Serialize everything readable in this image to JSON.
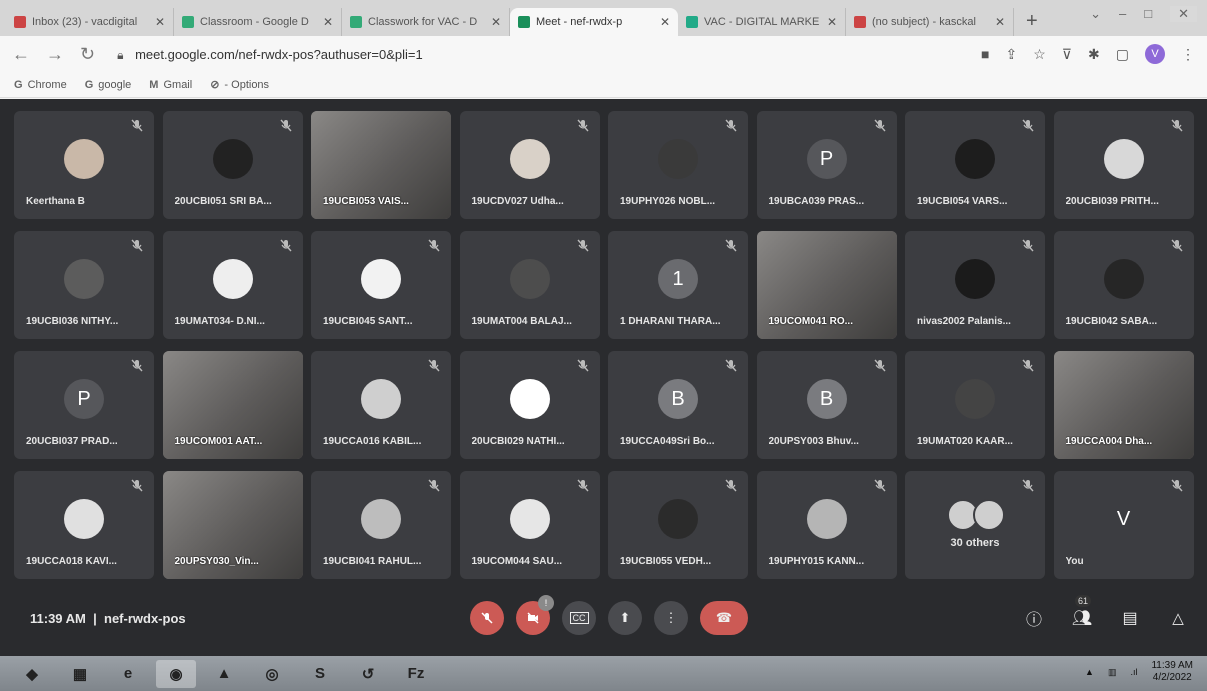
{
  "browser": {
    "tabs": [
      {
        "title": "Inbox (23) - vacdigital",
        "icon": "gmail-icon",
        "color": "#c44"
      },
      {
        "title": "Classroom - Google D",
        "icon": "classroom-icon",
        "color": "#3a7"
      },
      {
        "title": "Classwork for VAC - D",
        "icon": "classroom-icon",
        "color": "#3a7"
      },
      {
        "title": "Meet - nef-rwdx-p",
        "icon": "meet-icon",
        "color": "#1a8f5a",
        "active": true
      },
      {
        "title": "VAC - DIGITAL MARKE",
        "icon": "sheets-icon",
        "color": "#2a8"
      },
      {
        "title": "(no subject) - kasckal",
        "icon": "gmail-icon",
        "color": "#c44"
      }
    ],
    "url": "meet.google.com/nef-rwdx-pos?authuser=0&pli=1",
    "profile_initial": "V",
    "bookmarks": [
      {
        "label": "Chrome",
        "icon": "G"
      },
      {
        "label": "google",
        "icon": "G"
      },
      {
        "label": "Gmail",
        "icon": "M"
      },
      {
        "label": "- Options",
        "icon": "⊘"
      }
    ]
  },
  "participants": [
    {
      "name": "Keerthana B",
      "type": "photo",
      "color": "#c9b8a8"
    },
    {
      "name": "20UCBI051 SRI BA...",
      "type": "photo",
      "color": "#222"
    },
    {
      "name": "19UCBI053 VAIS...",
      "type": "video"
    },
    {
      "name": "19UCDV027 Udha...",
      "type": "photo",
      "color": "#d9d1c8"
    },
    {
      "name": "19UPHY026 NOBL...",
      "type": "photo",
      "color": "#3a3a3a"
    },
    {
      "name": "19UBCA039 PRAS...",
      "type": "initial",
      "initial": "P",
      "color": "#56575b"
    },
    {
      "name": "19UCBI054 VARS...",
      "type": "photo",
      "color": "#1d1d1d"
    },
    {
      "name": "20UCBI039 PRITH...",
      "type": "photo",
      "color": "#d8d8d8"
    },
    {
      "name": "19UCBI036 NITHY...",
      "type": "photo",
      "color": "#5c5c5c"
    },
    {
      "name": "19UMAT034- D.NI...",
      "type": "photo",
      "color": "#eeeeee"
    },
    {
      "name": "19UCBI045 SANT...",
      "type": "photo",
      "color": "#f2f2f2"
    },
    {
      "name": "19UMAT004 BALAJ...",
      "type": "photo",
      "color": "#4d4d4d"
    },
    {
      "name": "1 DHARANI THARA...",
      "type": "initial",
      "initial": "1",
      "color": "#6a6b6f"
    },
    {
      "name": "19UCOM041 RO...",
      "type": "video"
    },
    {
      "name": "nivas2002 Palanis...",
      "type": "photo",
      "color": "#1b1b1b"
    },
    {
      "name": "19UCBI042 SABA...",
      "type": "photo",
      "color": "#262626"
    },
    {
      "name": "20UCBI037 PRAD...",
      "type": "initial",
      "initial": "P",
      "color": "#56575b"
    },
    {
      "name": "19UCOM001 AAT...",
      "type": "video"
    },
    {
      "name": "19UCCA016 KABIL...",
      "type": "photo",
      "color": "#cfcfcf"
    },
    {
      "name": "20UCBI029 NATHI...",
      "type": "photo",
      "color": "#ffffff"
    },
    {
      "name": "19UCCA049Sri Bo...",
      "type": "initial",
      "initial": "B",
      "color": "#7a7b7f"
    },
    {
      "name": "20UPSY003 Bhuv...",
      "type": "initial",
      "initial": "B",
      "color": "#7a7b7f"
    },
    {
      "name": "19UMAT020 KAAR...",
      "type": "photo",
      "color": "#444"
    },
    {
      "name": "19UCCA004 Dha...",
      "type": "video"
    },
    {
      "name": "19UCCA018 KAVI...",
      "type": "photo",
      "color": "#e0e0e0"
    },
    {
      "name": "20UPSY030_Vin...",
      "type": "video"
    },
    {
      "name": "19UCBI041 RAHUL...",
      "type": "photo",
      "color": "#bdbdbd"
    },
    {
      "name": "19UCOM044 SAU...",
      "type": "photo",
      "color": "#e6e6e6"
    },
    {
      "name": "19UCBI055 VEDH...",
      "type": "photo",
      "color": "#2b2b2b"
    },
    {
      "name": "19UPHY015 KANN...",
      "type": "photo",
      "color": "#b5b5b5"
    },
    {
      "name": "30 others",
      "type": "others"
    },
    {
      "name": "You",
      "type": "initial",
      "initial": "V",
      "color": "#3c3d41"
    }
  ],
  "meeting": {
    "time": "11:39 AM",
    "code": "nef-rwdx-pos",
    "people_count": "61",
    "badge_count": "!"
  },
  "taskbar": {
    "apps": [
      "start",
      "explorer",
      "ie",
      "chrome",
      "vlc",
      "app5",
      "skype",
      "app7",
      "filezilla"
    ],
    "clock_time": "11:39 AM",
    "clock_date": "4/2/2022"
  }
}
